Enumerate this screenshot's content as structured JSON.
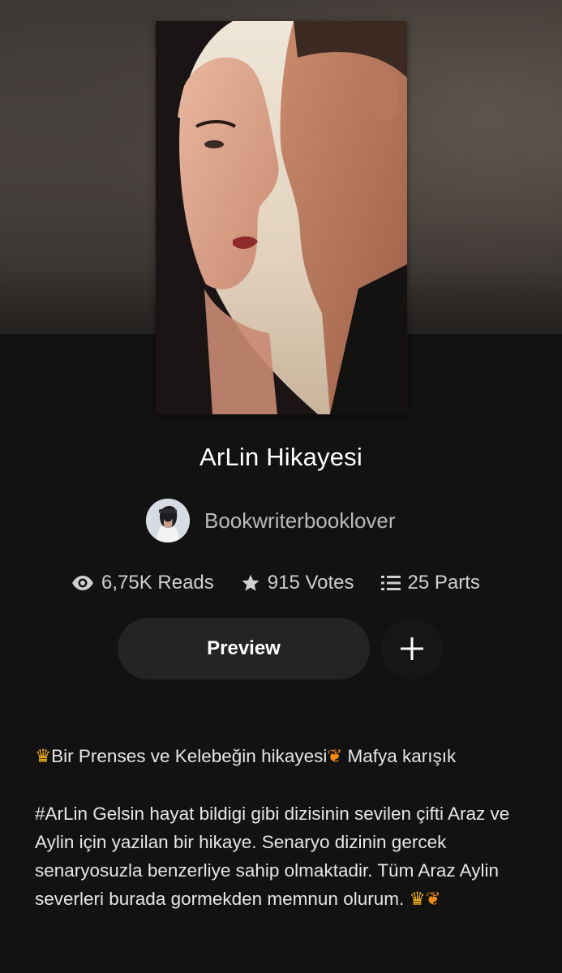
{
  "story": {
    "title": "ArLin Hikayesi",
    "author": "Bookwriterbooklover"
  },
  "stats": {
    "reads": "6,75K Reads",
    "votes": "915 Votes",
    "parts": "25 Parts"
  },
  "actions": {
    "preview_label": "Preview",
    "add_label": "+"
  },
  "description": {
    "line1_text": "Bir Prenses ve Kelebeğin hikayesi",
    "line1_tail": " Mafya karışık",
    "paragraph2": "#ArLin Gelsin hayat bildigi gibi dizisinin sevilen çifti Araz ve Aylin için yazilan bir hikaye. Senaryo dizinin gercek senaryosuzla benzerliye sahip olmaktadir. Tüm Araz Aylin severleri burada gormekden memnun olurum. "
  },
  "icons": {
    "reads": "eye-icon",
    "votes": "star-icon",
    "parts": "list-icon",
    "add": "plus-icon",
    "crown": "crown-emoji",
    "butterfly": "butterfly-emoji"
  },
  "colors": {
    "background": "#121212",
    "button": "#242424",
    "text_primary": "#ffffff",
    "text_secondary": "#b9b9b9"
  }
}
